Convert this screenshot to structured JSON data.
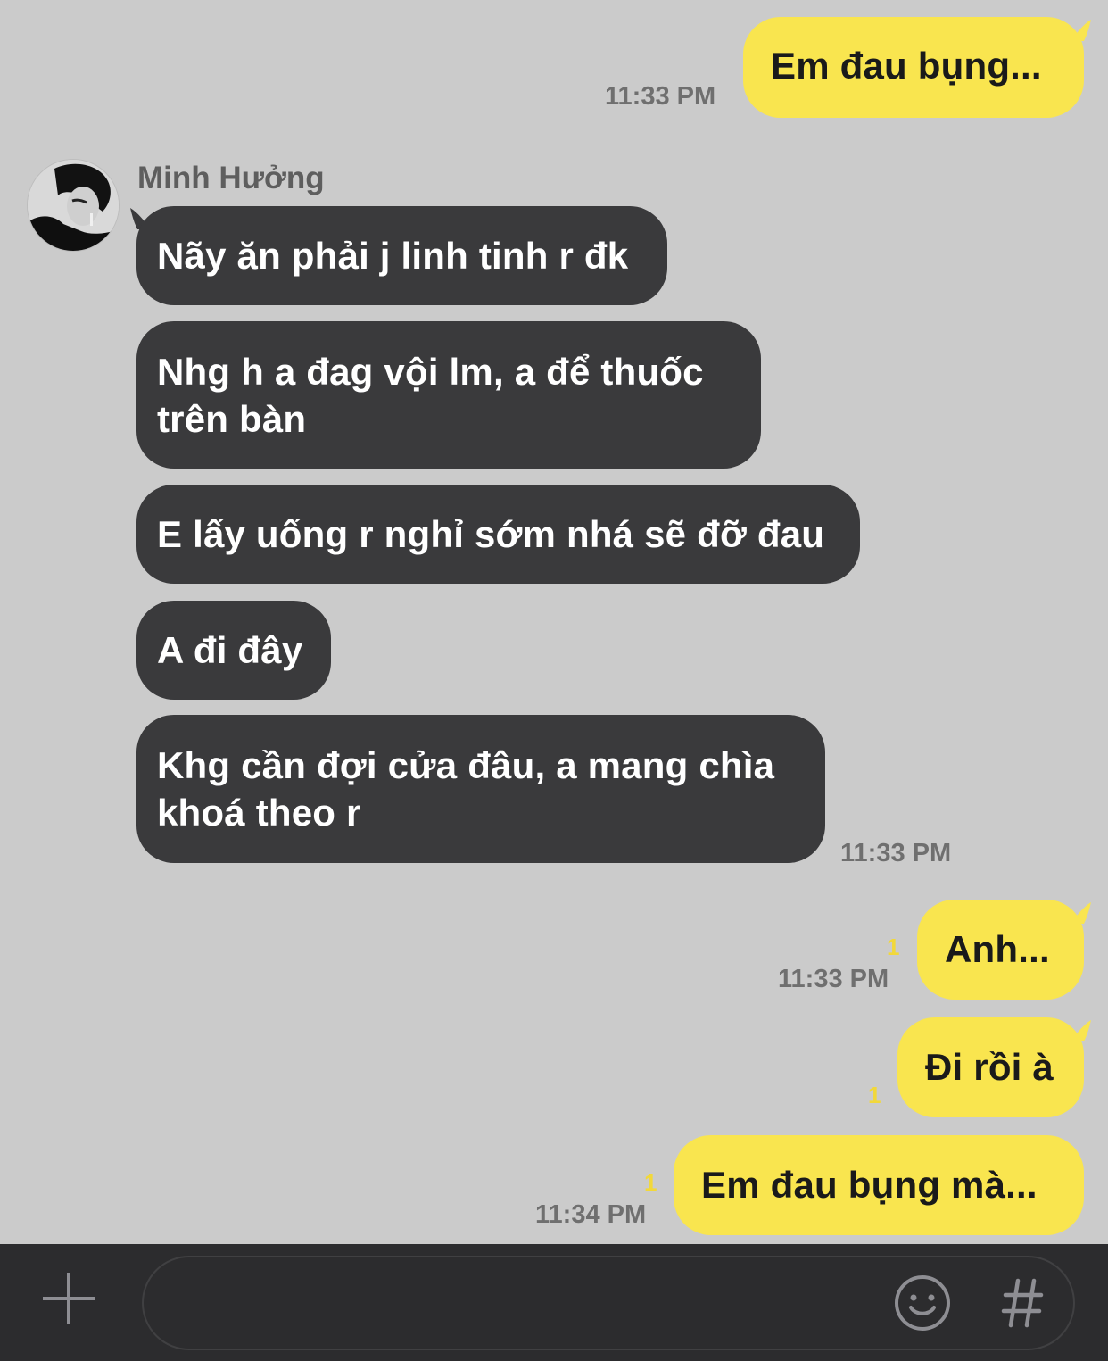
{
  "chat": {
    "contact_name": "Minh Hưởng",
    "messages": [
      {
        "direction": "out",
        "text": "Em đau bụng...",
        "time": "11:33 PM",
        "unread": ""
      },
      {
        "direction": "in",
        "lines": [
          "Nãy ăn phải j linh tinh r đk"
        ]
      },
      {
        "direction": "in",
        "lines": [
          "Nhg h a đag vội lm, a để thuốc",
          "trên bàn"
        ]
      },
      {
        "direction": "in",
        "lines": [
          "E lấy uống r nghỉ sớm nhá sẽ đỡ đau"
        ]
      },
      {
        "direction": "in",
        "lines": [
          "A đi đây"
        ]
      },
      {
        "direction": "in",
        "lines": [
          "Khg cần đợi cửa đâu, a mang chìa",
          "khoá theo r"
        ],
        "time": "11:33 PM"
      },
      {
        "direction": "out",
        "text": "Anh...",
        "time": "11:33 PM",
        "unread": "1"
      },
      {
        "direction": "out",
        "text": "Đi rồi à",
        "time": "",
        "unread": "1"
      },
      {
        "direction": "out",
        "text": "Em đau bụng mà...",
        "time": "11:34 PM",
        "unread": "1"
      }
    ]
  },
  "input_bar": {
    "placeholder": "",
    "plus_icon": "plus-icon",
    "emoji_icon": "smiley-icon",
    "hash_icon": "hash-icon"
  },
  "colors": {
    "background": "#cbcbcb",
    "outgoing_bubble": "#f9e54f",
    "incoming_bubble": "#3a3a3c",
    "unread_badge": "#f2d83a",
    "input_bar": "#2c2c2e"
  }
}
